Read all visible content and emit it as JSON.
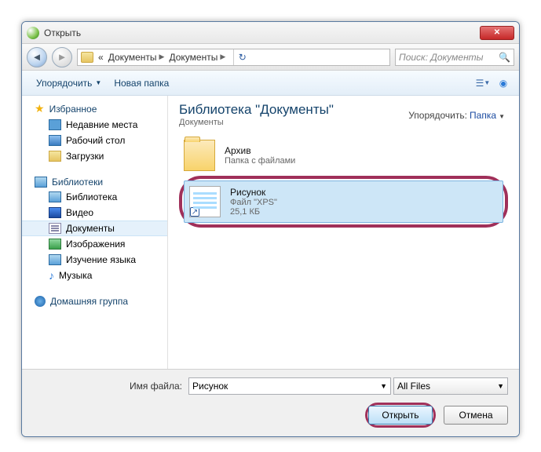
{
  "window": {
    "title": "Открыть"
  },
  "nav": {
    "crumb_sep": "«",
    "crumb1": "Документы",
    "crumb2": "Документы",
    "search_placeholder": "Поиск: Документы"
  },
  "toolbar": {
    "organize": "Упорядочить",
    "new_folder": "Новая папка"
  },
  "sidebar": {
    "favorites": "Избранное",
    "recent": "Недавние места",
    "desktop": "Рабочий стол",
    "downloads": "Загрузки",
    "libraries": "Библиотеки",
    "lib_lib": "Библиотека",
    "video": "Видео",
    "documents": "Документы",
    "images": "Изображения",
    "lang": "Изучение языка",
    "music": "Музыка",
    "homegroup": "Домашняя группа"
  },
  "main": {
    "lib_title": "Библиотека \"Документы\"",
    "lib_sub": "Документы",
    "sort_label": "Упорядочить:",
    "sort_value": "Папка",
    "items": [
      {
        "name": "Архив",
        "desc": "Папка с файлами"
      },
      {
        "name": "Рисунок",
        "desc": "Файл \"XPS\"",
        "size": "25,1 КБ"
      }
    ]
  },
  "footer": {
    "filename_label": "Имя файла:",
    "filename_value": "Рисунок",
    "filter": "All Files",
    "open": "Открыть",
    "cancel": "Отмена"
  }
}
